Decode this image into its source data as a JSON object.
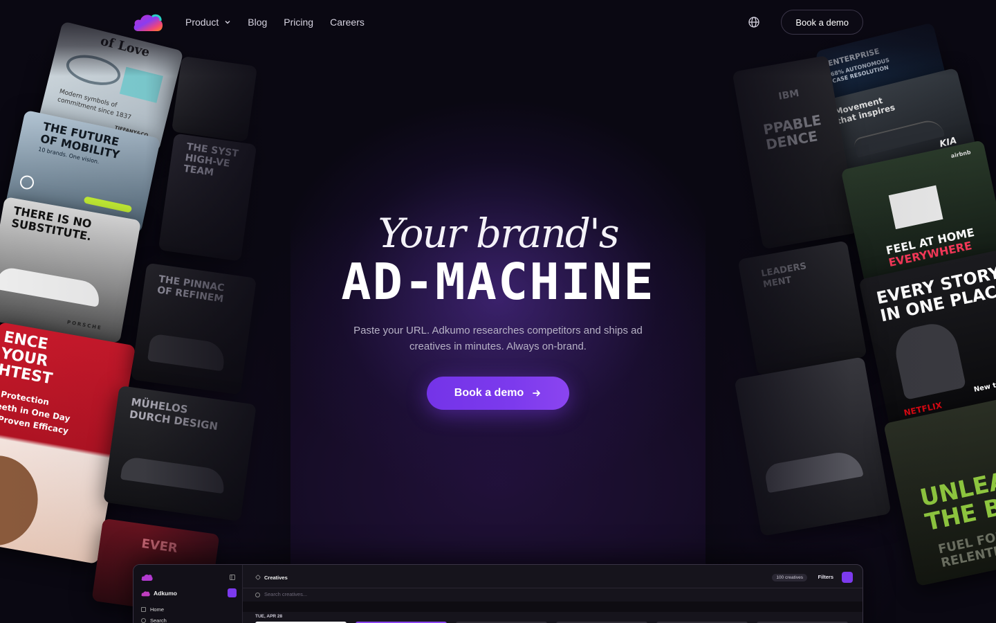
{
  "nav": {
    "links": [
      {
        "label": "Product",
        "has_dropdown": true
      },
      {
        "label": "Blog"
      },
      {
        "label": "Pricing"
      },
      {
        "label": "Careers"
      }
    ],
    "cta_label": "Book a demo",
    "globe_icon": "globe-icon"
  },
  "hero": {
    "script_title": "Your brand's",
    "main_title": "AD-MACHINE",
    "subtitle_line1": "Paste your URL. Adkumo researches competitors and ships ad",
    "subtitle_line2": "creatives in minutes. Always on-brand.",
    "cta_label": "Book a demo"
  },
  "ads": {
    "left": [
      {
        "line1": "of Love",
        "line2": "Modern symbols of",
        "line3": "commitment since 1837",
        "brand": "TIFFANY&Co."
      },
      {
        "line1": "THE FUTURE",
        "line2": "OF MOBILITY",
        "line3": "10 brands. One vision.",
        "brand": "VW"
      },
      {
        "line1": "THERE IS NO",
        "line2": "SUBSTITUTE.",
        "line3": "PORSCHE"
      },
      {
        "line1": "ENCE",
        "line2": "YOUR",
        "line3": "HTEST",
        "body1": "r Protection",
        "body2": "Teeth in One Day",
        "body3": "y Proven Efficacy"
      },
      {
        "line1": "THE SYST",
        "line2": "HIGH-VE",
        "line3": "TEAM"
      },
      {
        "line1": "THE PINNAC",
        "line2": "OF REFINEM"
      },
      {
        "line1": "MÜHELOS",
        "line2": "DURCH DESIGN"
      },
      {
        "line1": "EVER"
      }
    ],
    "right": [
      {
        "line1": "ENTERPRISE",
        "line2": "68% AUTONOMOUS",
        "line3": "CASE RESOLUTION"
      },
      {
        "line1": "Movement",
        "line2": "that inspires",
        "brand": "KIA"
      },
      {
        "line1": "PPABLE",
        "line2": "DENCE",
        "brand": "IBM"
      },
      {
        "line1": "FEEL AT HOME",
        "line2": "EVERYWHERE",
        "brand": "airbnb"
      },
      {
        "line1": "EVERY STORY",
        "line2": "IN ONE PLACE",
        "brand": "NETFLIX",
        "note": "New titles"
      },
      {
        "line1": "LEADERS",
        "line2": "MENT"
      },
      {
        "line1": "UNLEAS",
        "line2": "THE BE",
        "line3": "FUEL FOR",
        "line4": "RELENTLE"
      }
    ]
  },
  "app_preview": {
    "workspace": "Adkumo",
    "sidebar_items": [
      "Home",
      "Search"
    ],
    "page_title": "Creatives",
    "count_badge": "100 creatives",
    "filters_label": "Filters",
    "search_placeholder": "Search creatives...",
    "date_label": "TUE, APR 28"
  },
  "colors": {
    "accent": "#7c3aed",
    "background": "#0a0812",
    "text_muted": "#b7b2c6"
  }
}
